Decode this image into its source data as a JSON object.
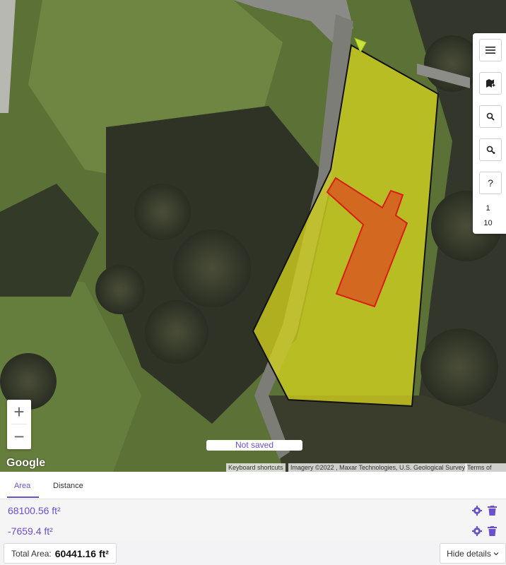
{
  "map": {
    "google_logo": "Google",
    "not_saved": "Not saved",
    "attribution": {
      "keyboard": "Keyboard shortcuts",
      "imagery": "Imagery ©2022 , Maxar Technologies, U.S. Geological Survey",
      "terms": "Terms of Use"
    },
    "zoom_in": "+",
    "zoom_out": "−",
    "polygon_colors": {
      "lot_fill": "#d4d21f",
      "lot_stroke": "#111111",
      "house_fill": "#e0401f",
      "house_stroke": "#d81e10"
    }
  },
  "toolbar": {
    "icons": [
      "menu-icon",
      "map-add-icon",
      "search-icon",
      "search-settings-icon",
      "help-icon"
    ],
    "help_label": "?",
    "num_top": "1",
    "num_bottom": "10"
  },
  "tabs": [
    {
      "label": "Area",
      "active": true
    },
    {
      "label": "Distance",
      "active": false
    }
  ],
  "measurements": [
    {
      "value": "68100.56 ft²"
    },
    {
      "value": "-7659.4 ft²"
    }
  ],
  "footer": {
    "total_label": "Total Area:",
    "total_value": "60441.16 ft²",
    "hide_details": "Hide details"
  },
  "accent_color": "#6a4fcf"
}
